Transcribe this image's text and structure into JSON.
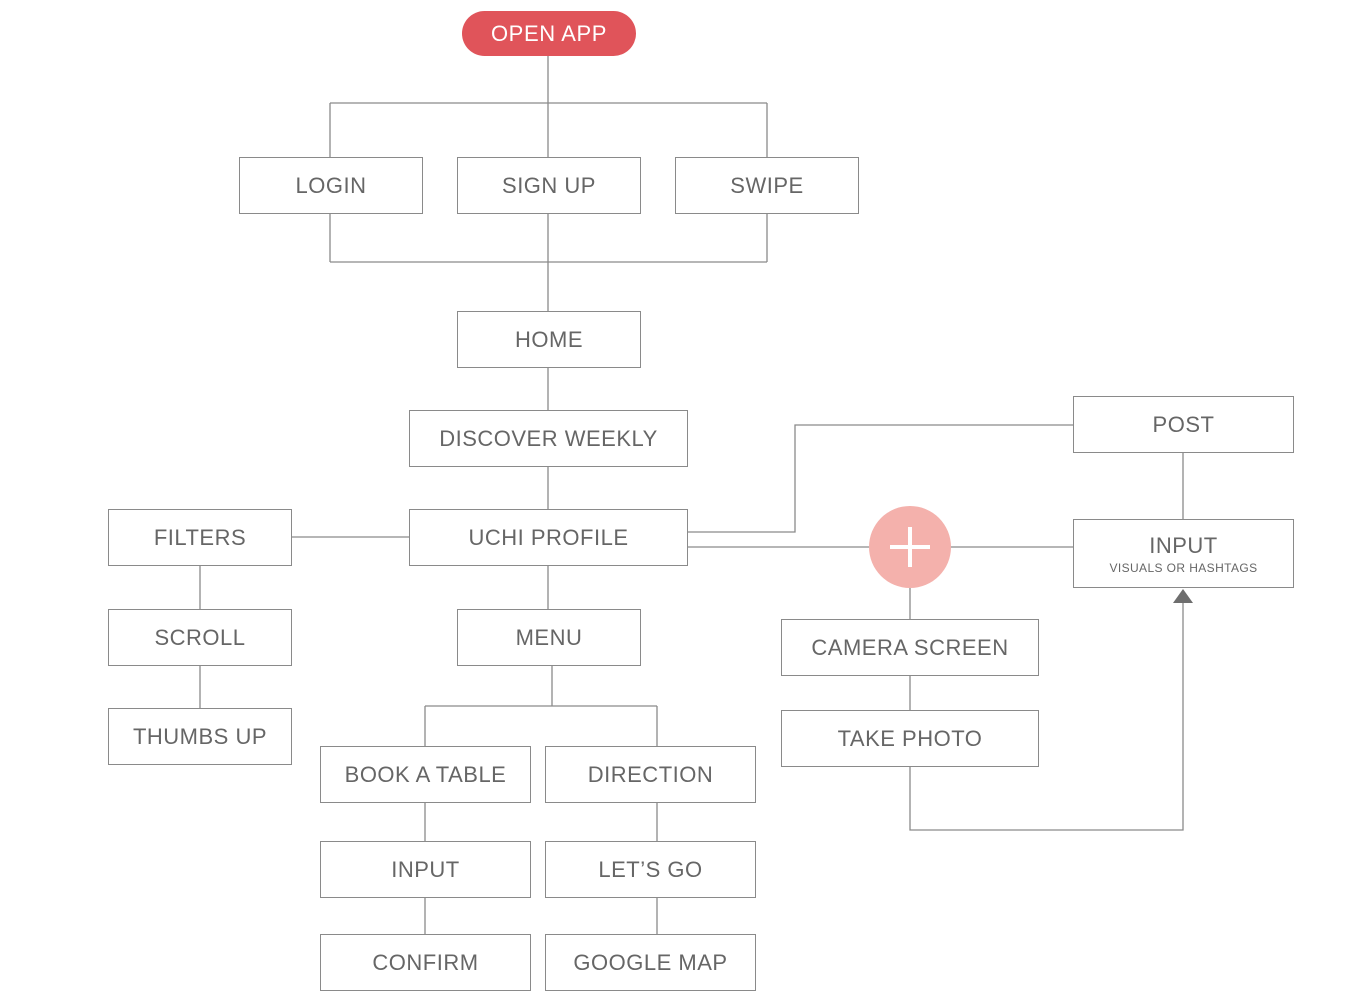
{
  "start": {
    "label": "OPEN APP",
    "color": "#e0545a"
  },
  "auth": {
    "login": "LOGIN",
    "sign_up": "SIGN UP",
    "swipe": "SWIPE"
  },
  "main": {
    "home": "HOME",
    "discover_weekly": "DISCOVER WEEKLY",
    "uchi_profile": "UCHI PROFILE",
    "menu": "MENU"
  },
  "filters_branch": {
    "filters": "FILTERS",
    "scroll": "SCROLL",
    "thumbs_up": "THUMBS UP"
  },
  "menu_branch": {
    "book_a_table": "BOOK A TABLE",
    "input": "INPUT",
    "confirm": "CONFIRM",
    "direction": "DIRECTION",
    "lets_go": "LET’S GO",
    "google_map": "GOOGLE MAP"
  },
  "post_branch": {
    "add_icon": "plus-icon",
    "add_color": "#f4b1ac",
    "camera_screen": "CAMERA SCREEN",
    "take_photo": "TAKE PHOTO",
    "input": "INPUT",
    "input_note": "VISUALS OR HASHTAGS",
    "post": "POST"
  },
  "colors": {
    "line": "#8a8a8a",
    "text": "#666666",
    "arrow": "#6e6e6e"
  }
}
